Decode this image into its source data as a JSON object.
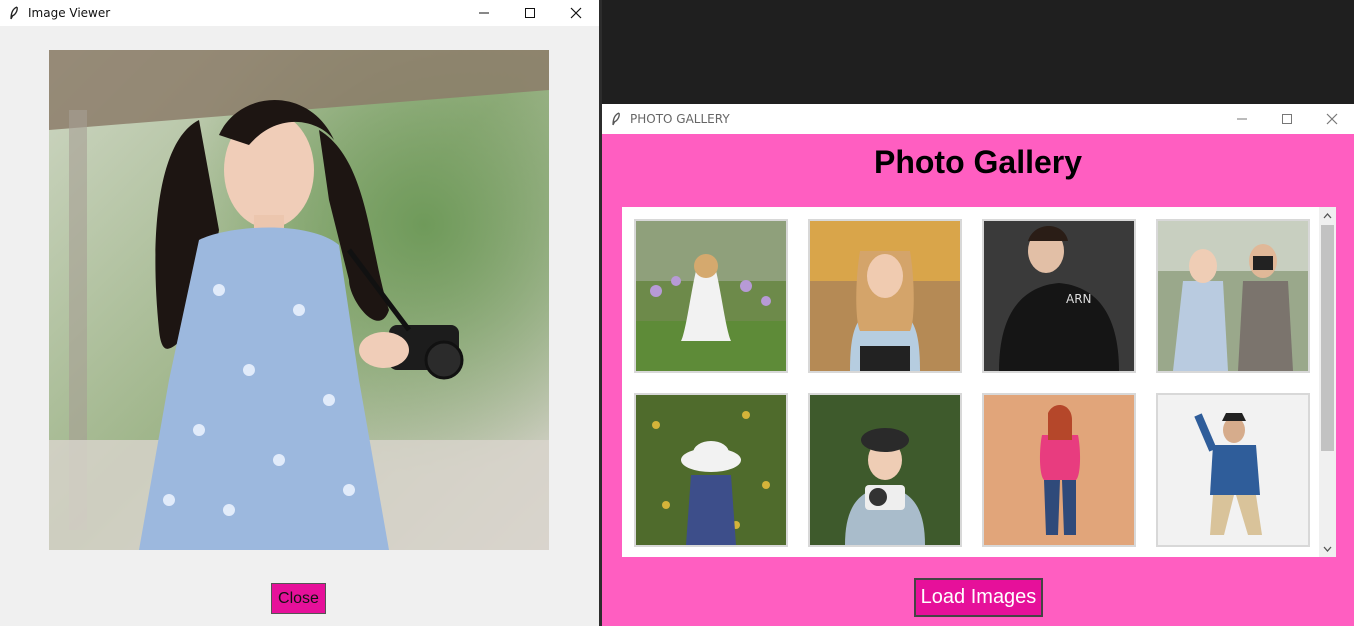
{
  "viewer": {
    "title": "Image Viewer",
    "close_label": "Close"
  },
  "gallery": {
    "title": "PHOTO GALLERY",
    "heading": "Photo Gallery",
    "load_label": "Load Images",
    "thumbnails": [
      "girl-in-flower-field",
      "smiling-woman-autumn",
      "man-leather-jacket",
      "couple-taking-photo",
      "child-in-sun-hat",
      "boy-with-camera",
      "woman-pink-sweater",
      "man-pointing-up"
    ]
  },
  "colors": {
    "gallery_bg": "#ff5ec1",
    "button_bg": "#e6109a",
    "viewer_bg": "#f0f0f0"
  },
  "icons": [
    "feather-icon",
    "minimize-icon",
    "maximize-icon",
    "close-icon",
    "chevron-up-icon",
    "chevron-down-icon"
  ]
}
